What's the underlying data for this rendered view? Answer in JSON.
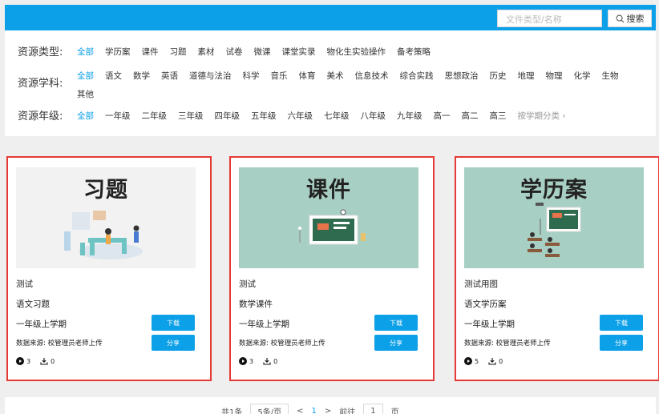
{
  "search": {
    "placeholder": "文件类型/名称",
    "button_label": "搜索"
  },
  "filters": {
    "type": {
      "label": "资源类型:",
      "options": [
        "全部",
        "学历案",
        "课件",
        "习题",
        "素材",
        "试卷",
        "微课",
        "课堂实录",
        "物化生实验操作",
        "备考策略"
      ]
    },
    "subject": {
      "label": "资源学科:",
      "options": [
        "全部",
        "语文",
        "数学",
        "英语",
        "道德与法治",
        "科学",
        "音乐",
        "体育",
        "美术",
        "信息技术",
        "综合实践",
        "思想政治",
        "历史",
        "地理",
        "物理",
        "化学",
        "生物",
        "其他"
      ]
    },
    "grade": {
      "label": "资源年级:",
      "options": [
        "全部",
        "一年级",
        "二年级",
        "三年级",
        "四年级",
        "五年级",
        "六年级",
        "七年级",
        "八年级",
        "九年级",
        "高一",
        "高二",
        "高三"
      ],
      "more": "按学期分类 ›"
    }
  },
  "cards": [
    {
      "image_title": "习题",
      "name": "测试",
      "subtitle": "语文习题",
      "term": "一年级上学期",
      "source": "数据来源: 校管理员老师上传",
      "download_label": "下载",
      "share_label": "分享",
      "views": "3",
      "downloads": "0",
      "image_bg": "#f2f2f2"
    },
    {
      "image_title": "课件",
      "name": "测试",
      "subtitle": "数学课件",
      "term": "一年级上学期",
      "source": "数据来源: 校管理员老师上传",
      "download_label": "下载",
      "share_label": "分享",
      "views": "3",
      "downloads": "0",
      "image_bg": "#a8cfc3"
    },
    {
      "image_title": "学历案",
      "name": "测试用图",
      "subtitle": "语文学历案",
      "term": "一年级上学期",
      "source": "数据来源: 校管理员老师上传",
      "download_label": "下载",
      "share_label": "分享",
      "views": "5",
      "downloads": "0",
      "image_bg": "#a8cfc3"
    }
  ],
  "pager": {
    "total_label": "共1条",
    "page_size": "5条/页",
    "prev": "<",
    "current": "1",
    "next": ">",
    "goto_label": "前往",
    "goto_value": "1",
    "page_unit": "页"
  }
}
